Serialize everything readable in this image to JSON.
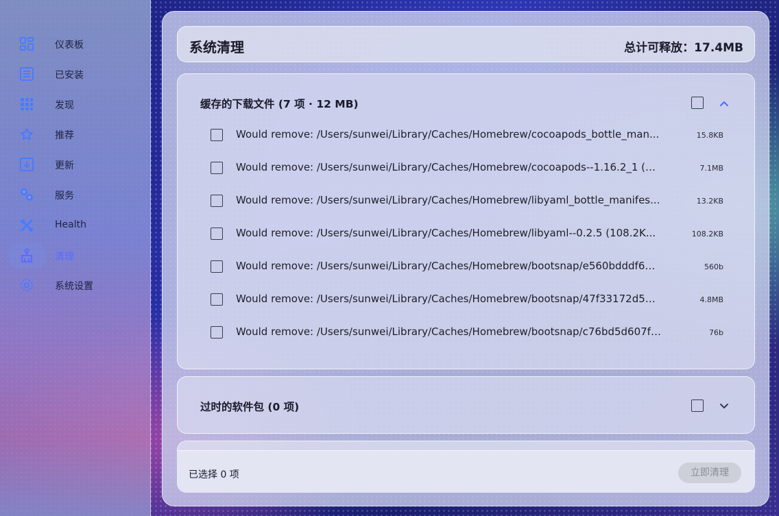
{
  "sidebar": {
    "items": [
      {
        "label": "仪表板",
        "icon": "dashboard-icon"
      },
      {
        "label": "已安装",
        "icon": "list-icon"
      },
      {
        "label": "发现",
        "icon": "grid-icon"
      },
      {
        "label": "推荐",
        "icon": "star-icon"
      },
      {
        "label": "更新",
        "icon": "download-icon"
      },
      {
        "label": "服务",
        "icon": "gears-icon"
      },
      {
        "label": "Health",
        "icon": "tools-icon"
      },
      {
        "label": "清理",
        "icon": "broom-icon"
      },
      {
        "label": "系统设置",
        "icon": "settings-icon"
      }
    ],
    "active_index": 7
  },
  "header": {
    "title": "系统清理",
    "total": "总计可释放：17.4MB"
  },
  "cache_section": {
    "title": "缓存的下载文件 (7 项 · 12 MB)",
    "expanded": true,
    "rows": [
      {
        "text": "Would remove: /Users/sunwei/Library/Caches/Homebrew/cocoapods_bottle_man...",
        "size": "15.8KB"
      },
      {
        "text": "Would remove: /Users/sunwei/Library/Caches/Homebrew/cocoapods--1.16.2_1 (7....",
        "size": "7.1MB"
      },
      {
        "text": "Would remove: /Users/sunwei/Library/Caches/Homebrew/libyaml_bottle_manifes...",
        "size": "13.2KB"
      },
      {
        "text": "Would remove: /Users/sunwei/Library/Caches/Homebrew/libyaml--0.2.5 (108.2K...",
        "size": "108.2KB"
      },
      {
        "text": "Would remove: /Users/sunwei/Library/Caches/Homebrew/bootsnap/e560bdddf618...",
        "size": "560b"
      },
      {
        "text": "Would remove: /Users/sunwei/Library/Caches/Homebrew/bootsnap/47f33172d54...",
        "size": "4.8MB"
      },
      {
        "text": "Would remove: /Users/sunwei/Library/Caches/Homebrew/bootsnap/c76bd5d607f5...",
        "size": "76b"
      }
    ]
  },
  "outdated_section": {
    "title": "过时的软件包 (0 项)",
    "expanded": false
  },
  "footer": {
    "selected": "已选择 0 项",
    "clean_button": "立即清理"
  },
  "colors": {
    "accent": "#5b6bff",
    "icon_blue": "#4a7bff"
  }
}
